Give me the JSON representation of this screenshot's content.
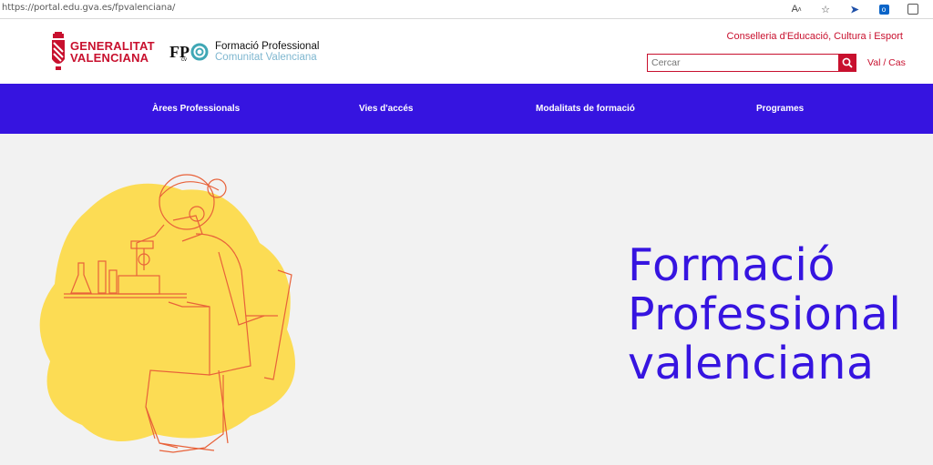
{
  "browser": {
    "url": "https://portal.edu.gva.es/fpvalenciana/",
    "icons": [
      "read-aloud-icon",
      "favorite-icon",
      "extension-icon",
      "outlook-icon",
      "pocket-icon"
    ]
  },
  "header": {
    "gva_logo_line1": "GENERALITAT",
    "gva_logo_line2": "VALENCIANA",
    "fp_logo_line1": "Formació Professional",
    "fp_logo_line2": "Comunitat Valenciana",
    "conselleria": "Conselleria d'Educació, Cultura i Esport",
    "search_placeholder": "Cercar",
    "lang": "Val / Cas"
  },
  "nav": {
    "items": [
      {
        "label": "Àrees Professionals"
      },
      {
        "label": "Vies d'accés"
      },
      {
        "label": "Modalitats de formació"
      },
      {
        "label": "Programes"
      }
    ]
  },
  "hero": {
    "title_line1": "Formació",
    "title_line2": "Professional",
    "title_line3": "valenciana"
  },
  "colors": {
    "brand_red": "#c8102e",
    "nav_blue": "#3614e0",
    "blob_yellow": "#fcdc54",
    "line_orange": "#e8623a"
  }
}
